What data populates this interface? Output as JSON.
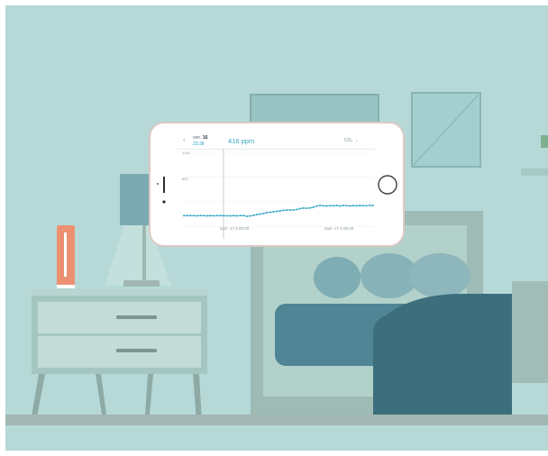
{
  "app": {
    "back_icon": "chevron-left-icon",
    "date_prefix": "ven.",
    "date_day": "16",
    "date_time": "23:38",
    "reading": "416 ppm",
    "gas": "CO₂",
    "gas_menu_icon": "chevron-down-icon",
    "accent": "#35a7c4"
  },
  "chart_data": {
    "type": "line",
    "y_ticks": [
      "1000",
      "800"
    ],
    "x_labels": [
      "sam. 17 à 00:00",
      "sam. 17 à 06:00"
    ],
    "ylim": [
      330,
      1000
    ],
    "grid": true,
    "series": [
      {
        "values": [
          488,
          489,
          488,
          488,
          487,
          489,
          488,
          487,
          488,
          487,
          488,
          489,
          488,
          487,
          487,
          488,
          487,
          489,
          488,
          482,
          486,
          491,
          497,
          501,
          506,
          513,
          516,
          519,
          523,
          527,
          531,
          533,
          534,
          533,
          538,
          545,
          549,
          548,
          550,
          556,
          566,
          570,
          568,
          567,
          569,
          568,
          570,
          566,
          571,
          569,
          567,
          569,
          568,
          570,
          569,
          568,
          571,
          570
        ]
      }
    ]
  }
}
